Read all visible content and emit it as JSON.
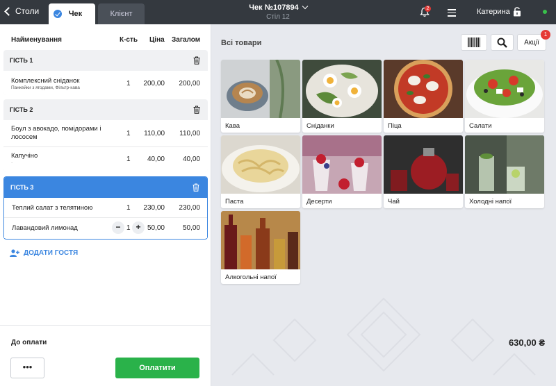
{
  "topbar": {
    "back_label": "Столи",
    "tabs": [
      {
        "label": "Чек"
      },
      {
        "label": "Клієнт"
      }
    ],
    "order_title": "Чек №107894",
    "order_subtitle": "Стіл 12",
    "notifications_count": "2",
    "user_name": "Катерина",
    "status_color": "#39c14b"
  },
  "order": {
    "columns": {
      "name": "Найменування",
      "qty": "К-сть",
      "price": "Ціна",
      "total": "Загалом"
    },
    "guests": [
      {
        "label": "ГІСТЬ 1",
        "items": [
          {
            "name": "Комплексний сніданок",
            "note": "Панкейки з ягодами, Фільтр-кава",
            "qty": "1",
            "price": "200,00",
            "total": "200,00"
          }
        ]
      },
      {
        "label": "ГІСТЬ 2",
        "items": [
          {
            "name": "Боул з авокадо, помідорами і лососем",
            "qty": "1",
            "price": "110,00",
            "total": "110,00"
          },
          {
            "name": "Капучіно",
            "note": "·",
            "qty": "1",
            "price": "40,00",
            "total": "40,00"
          }
        ]
      },
      {
        "label": "ГІСТЬ 3",
        "items": [
          {
            "name": "Теплий салат з телятиною",
            "qty": "1",
            "price": "230,00",
            "total": "230,00"
          },
          {
            "name": "Лавандовий лимонад",
            "qty": "1",
            "price": "50,00",
            "total": "50,00",
            "stepper": {
              "minus": "−",
              "plus": "+"
            }
          }
        ]
      }
    ],
    "add_guest_label": "ДОДАТИ ГОСТЯ",
    "to_pay_label": "До оплати",
    "to_pay_amount": "630,00 ₴",
    "more_label": "•••",
    "pay_label": "Оплатити"
  },
  "catalog": {
    "title": "Всі товари",
    "promo_label": "Акції",
    "promo_count": "1",
    "categories": [
      {
        "label": "Кава",
        "icon": "coffee-image"
      },
      {
        "label": "Сніданки",
        "icon": "breakfast-image"
      },
      {
        "label": "Піца",
        "icon": "pizza-image"
      },
      {
        "label": "Салати",
        "icon": "salad-image"
      },
      {
        "label": "Паста",
        "icon": "pasta-image"
      },
      {
        "label": "Десерти",
        "icon": "dessert-image"
      },
      {
        "label": "Чай",
        "icon": "tea-image"
      },
      {
        "label": "Холодні напої",
        "icon": "cold-drinks-image"
      },
      {
        "label": "Алкогольні напої",
        "icon": "alcohol-image"
      }
    ],
    "accent_color": "#3b86e0",
    "pay_color": "#2ab24a"
  }
}
